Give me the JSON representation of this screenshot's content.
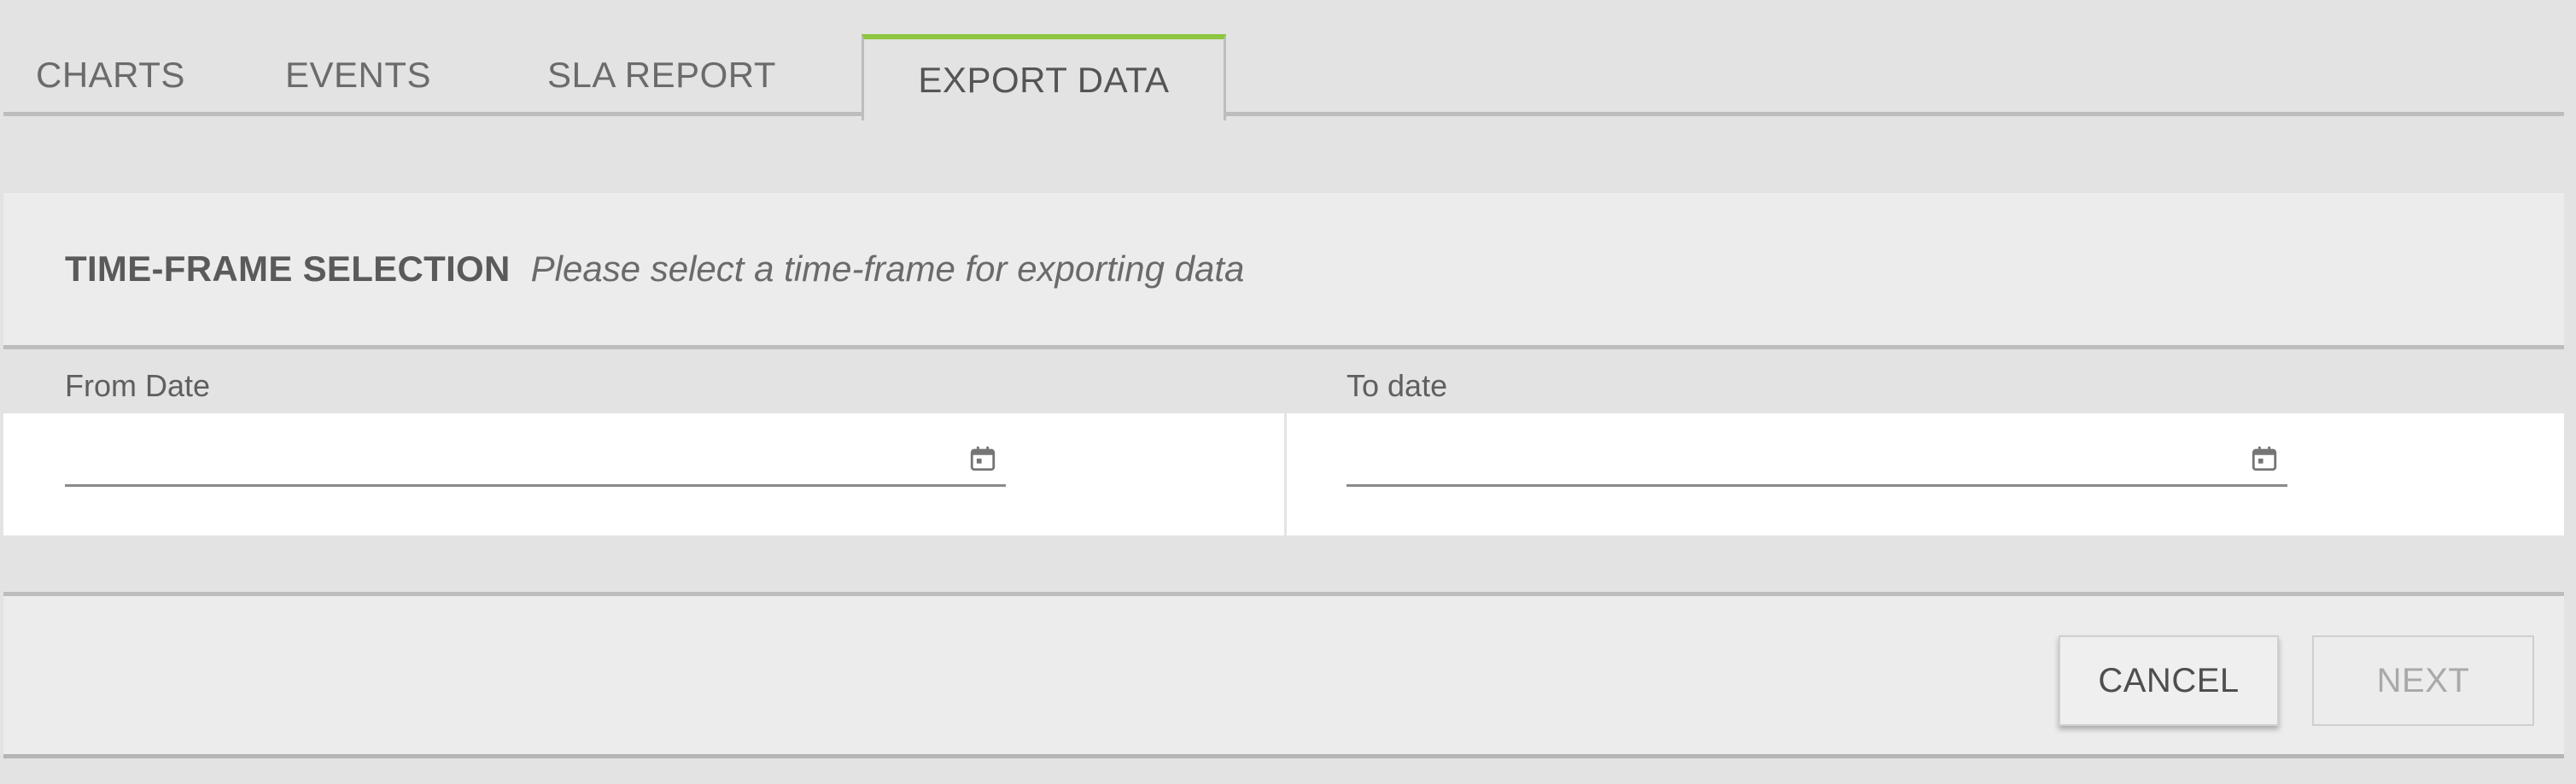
{
  "tabs": {
    "charts": "CHARTS",
    "events": "EVENTS",
    "sla_report": "SLA REPORT",
    "export_data": "EXPORT DATA",
    "active": "export_data",
    "active_accent_color": "#8dc63f"
  },
  "panel": {
    "title": "TIME-FRAME SELECTION",
    "subtitle": "Please select a time-frame for exporting data",
    "from_date": {
      "label": "From Date",
      "value": "",
      "icon": "calendar-icon"
    },
    "to_date": {
      "label": "To date",
      "value": "",
      "icon": "calendar-icon"
    }
  },
  "actions": {
    "cancel_label": "CANCEL",
    "next_label": "NEXT",
    "next_disabled": true
  }
}
